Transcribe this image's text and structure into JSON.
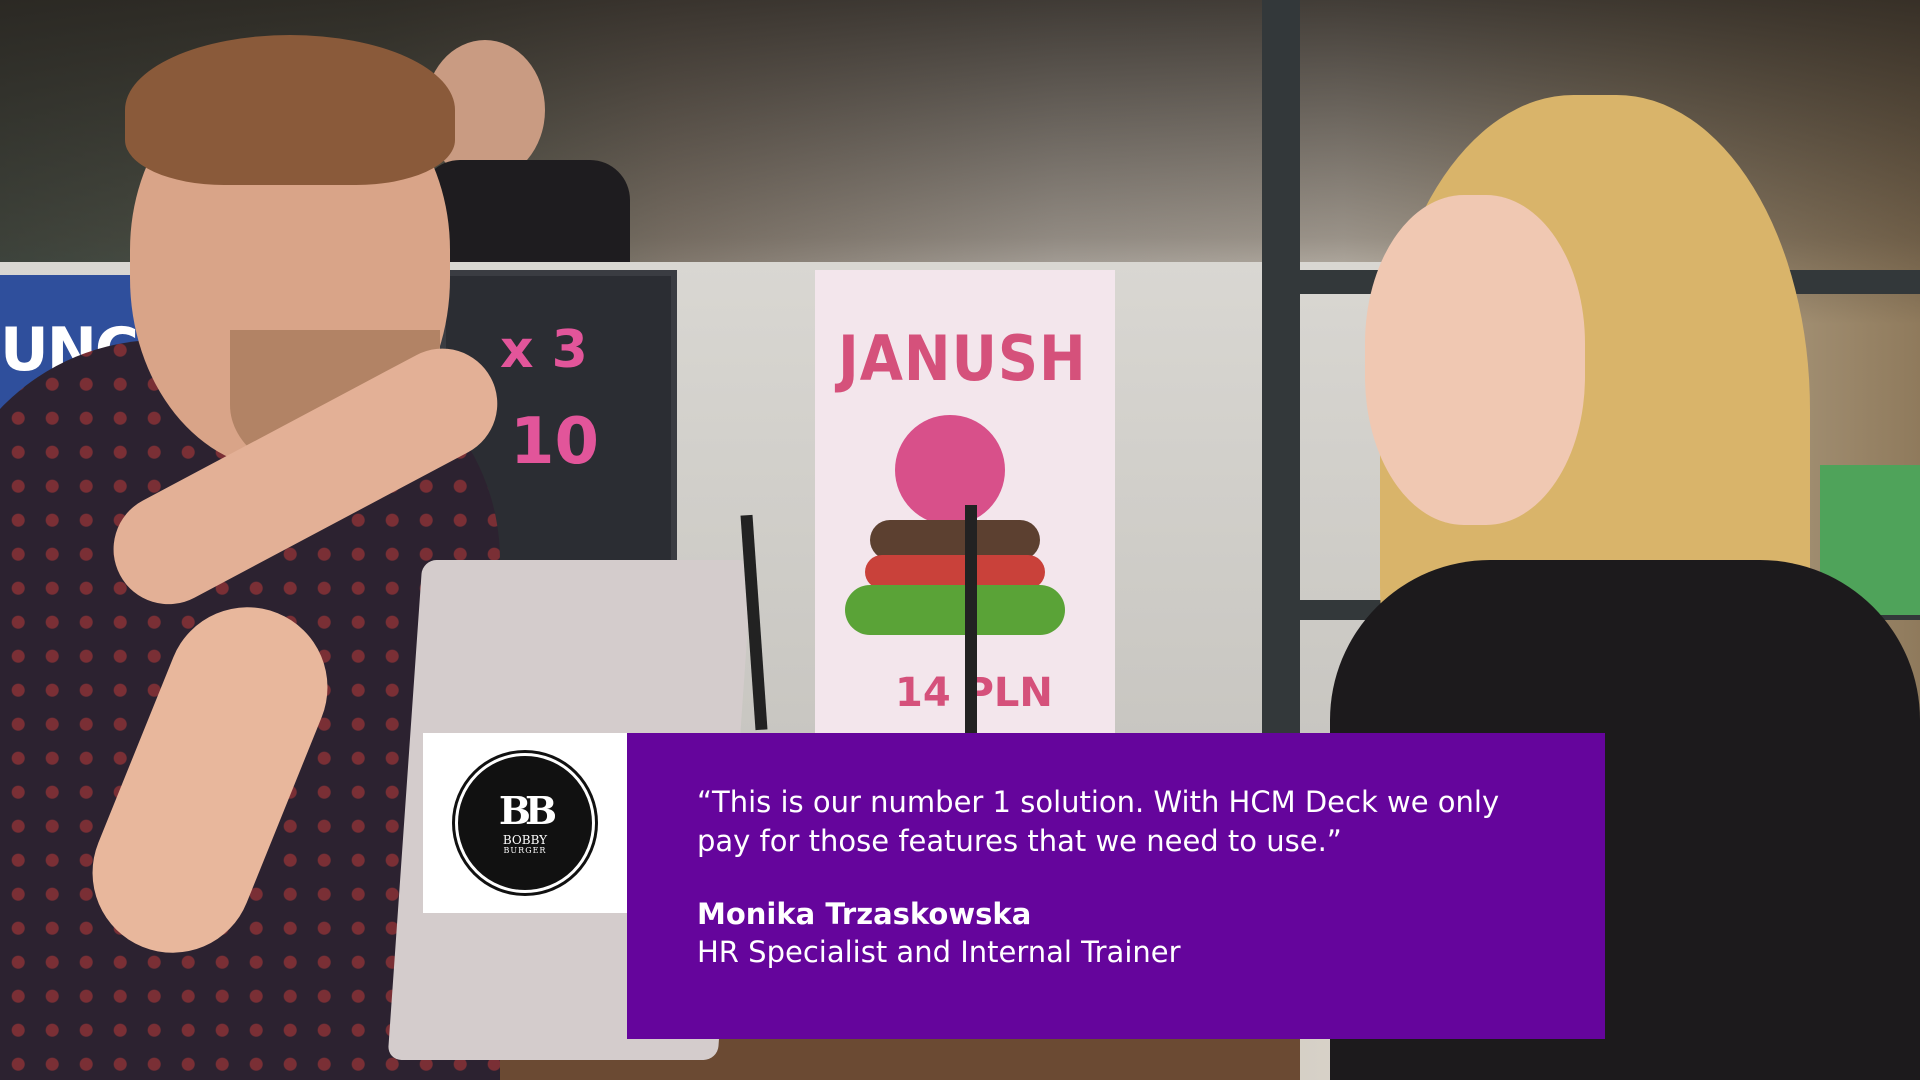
{
  "background": {
    "signs": {
      "left": "UNCH",
      "chalk_top": "x 3",
      "chalk_price": "10",
      "poster_title": "JANUSH",
      "poster_price": "14 PLN"
    }
  },
  "logo": {
    "monogram": "BB",
    "name": "BOBBY",
    "sub": "BURGER"
  },
  "testimonial": {
    "quote": "“This is our number 1 solution. With HCM Deck we only pay for those features that we need to use.”",
    "author_name": "Monika Trzaskowska",
    "author_title": "HR Specialist and Internal Trainer"
  },
  "colors": {
    "card_purple": "#65059c",
    "logo_bg": "#ffffff",
    "text": "#ffffff"
  }
}
